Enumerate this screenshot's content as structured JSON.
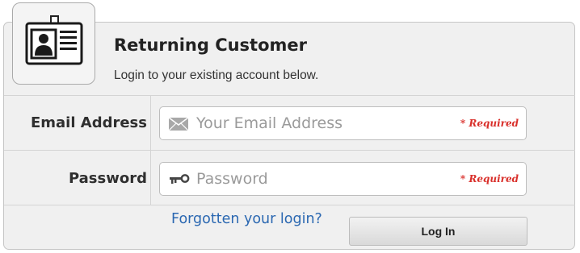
{
  "header": {
    "title": "Returning Customer",
    "subtitle": "Login to your existing account below.",
    "icon": "id-card-icon"
  },
  "form": {
    "email": {
      "label": "Email Address",
      "placeholder": "Your Email Address",
      "value": "",
      "required_text": "* Required",
      "icon": "envelope-icon"
    },
    "password": {
      "label": "Password",
      "placeholder": "Password",
      "value": "",
      "required_text": "* Required",
      "icon": "key-icon"
    },
    "forgot_link": "Forgotten your login?",
    "submit_label": "Log In"
  },
  "colors": {
    "panel_bg": "#f0f0f0",
    "link": "#2a67b1",
    "required": "#d9302b"
  }
}
